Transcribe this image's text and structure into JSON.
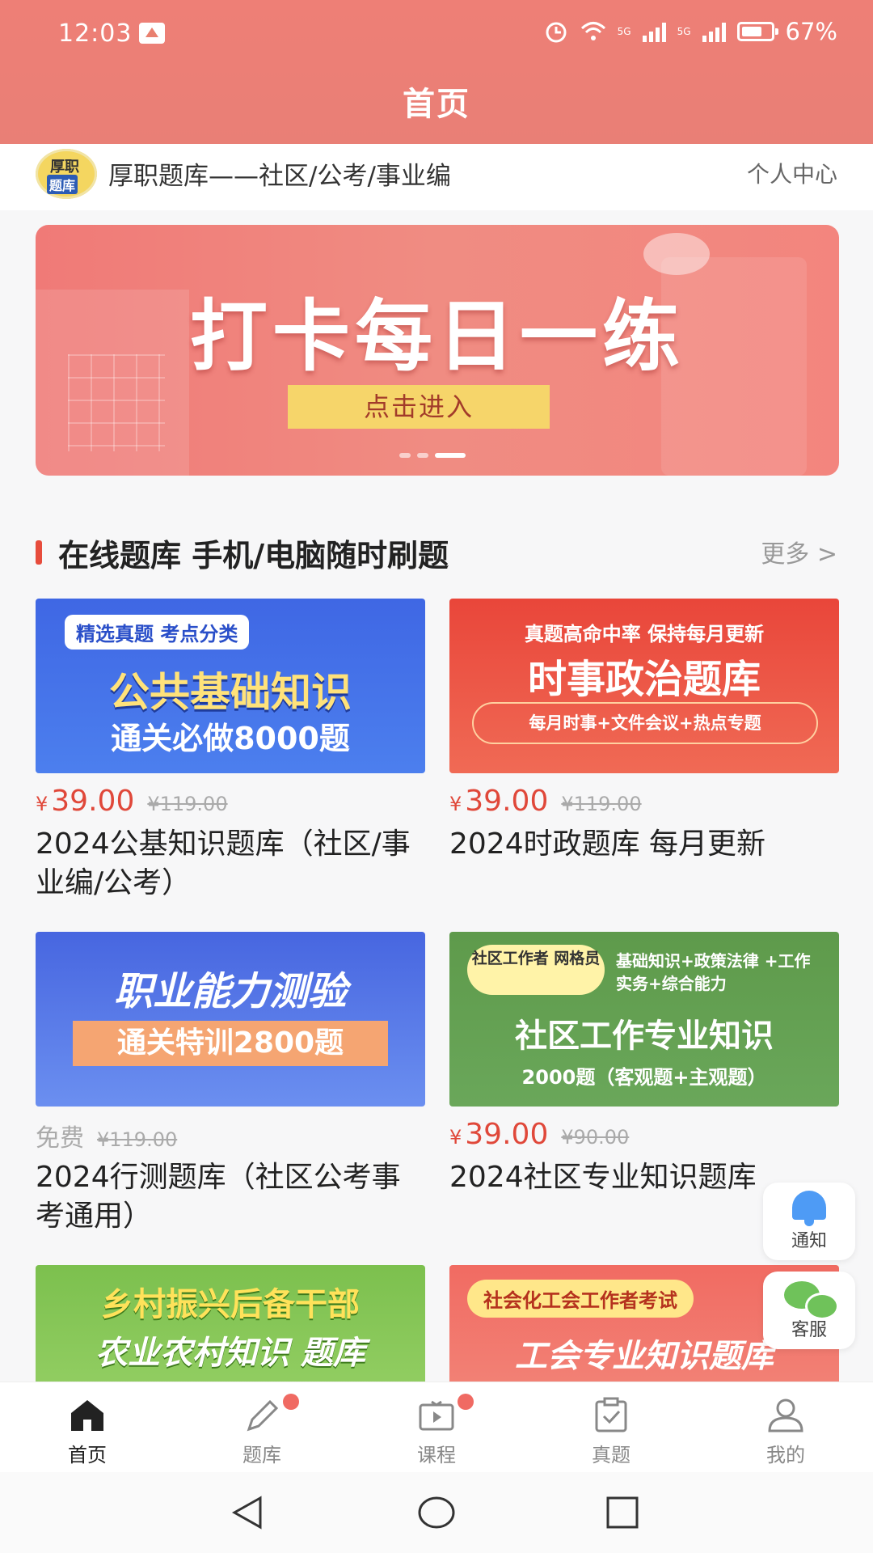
{
  "status_bar": {
    "time": "12:03",
    "network1": "5G",
    "network2": "5G",
    "battery": "67%"
  },
  "header": {
    "title": "首页"
  },
  "app_bar": {
    "logo_line1": "厚职",
    "logo_line2": "题库",
    "app_name": "厚职题库——社区/公考/事业编",
    "personal_center": "个人中心"
  },
  "banner": {
    "title": "打卡每日一练",
    "button": "点击进入"
  },
  "section": {
    "title": "在线题库 手机/电脑随时刷题",
    "more": "更多 >"
  },
  "products": [
    {
      "cover_tag": "精选真题 考点分类",
      "cover_title": "公共基础知识",
      "cover_sub": "通关必做8000题",
      "currency": "¥",
      "price": "39.00",
      "old_price": "¥119.00",
      "name": "2024公基知识题库（社区/事业编/公考）"
    },
    {
      "cover_tag": "真题高命中率  保持每月更新",
      "cover_title": "时事政治题库",
      "cover_sub": "每月时事+文件会议+热点专题",
      "currency": "¥",
      "price": "39.00",
      "old_price": "¥119.00",
      "name": "2024时政题库 每月更新"
    },
    {
      "cover_title": "职业能力测验",
      "cover_sub": "通关特训2800题",
      "price_label": "免费",
      "old_price": "¥119.00",
      "name": "2024行测题库（社区公考事考通用）"
    },
    {
      "cover_tag": "社区工作者 网格员",
      "cover_tag2": "基础知识+政策法律 +工作实务+综合能力",
      "cover_title": "社区工作专业知识",
      "cover_sub": "2000题（客观题+主观题）",
      "currency": "¥",
      "price": "39.00",
      "old_price": "¥90.00",
      "name": "2024社区专业知识题库"
    },
    {
      "cover_title": "乡村振兴后备干部",
      "cover_sub": "农业农村知识 题库"
    },
    {
      "cover_tag": "社会化工会工作者考试",
      "cover_title": "工会专业知识题库"
    }
  ],
  "floating": {
    "notice": "通知",
    "service": "客服"
  },
  "bottom_nav": [
    {
      "label": "首页",
      "icon": "home-icon",
      "active": true
    },
    {
      "label": "题库",
      "icon": "pencil-icon",
      "badge": true
    },
    {
      "label": "课程",
      "icon": "video-icon",
      "badge": true
    },
    {
      "label": "真题",
      "icon": "clipboard-icon"
    },
    {
      "label": "我的",
      "icon": "user-icon"
    }
  ],
  "colors": {
    "header": "#ee7f76",
    "accent": "#e74c3c",
    "price": "#e0483a",
    "banner_button": "#f6d56a"
  }
}
